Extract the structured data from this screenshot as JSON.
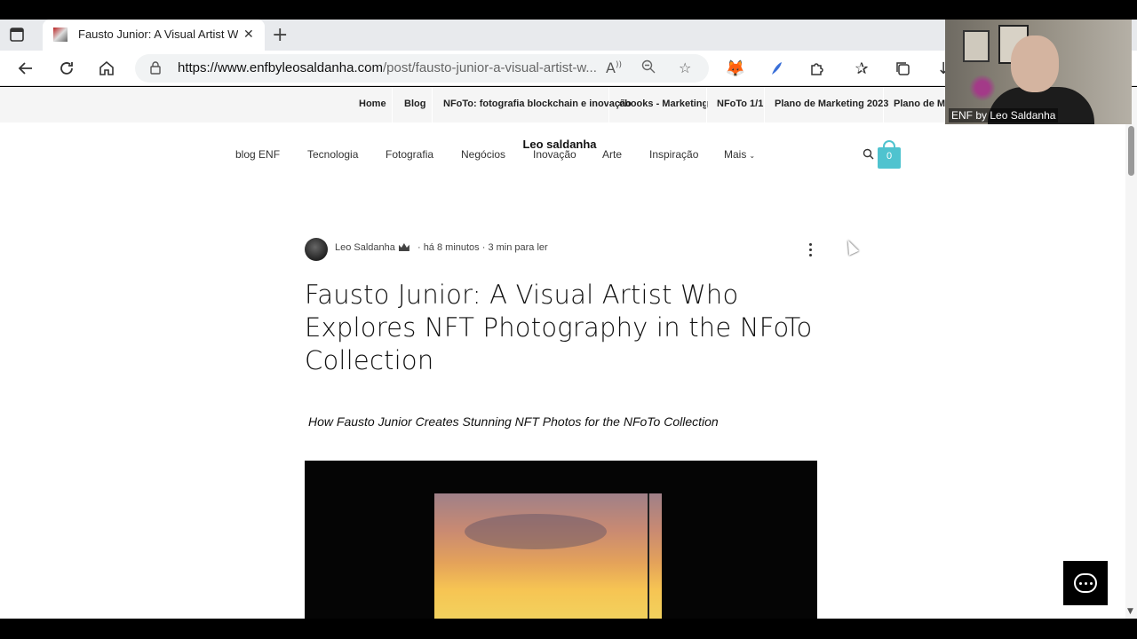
{
  "browser": {
    "tab_title": "Fausto Junior: A Visual Artist Who",
    "url_domain": "https://www.enfbyleosaldanha.com",
    "url_path": "/post/fausto-junior-a-visual-artist-w..."
  },
  "site_nav": {
    "links": [
      "Home",
      "Blog",
      "NFoTo: fotografia blockchain e inovação",
      "ebooks - Marketing",
      "NFoTo 1/1",
      "Plano de Marketing 2023",
      "Plano de Mar"
    ]
  },
  "site": {
    "brand": "Leo saldanha",
    "categories": [
      "blog ENF",
      "Tecnologia",
      "Fotografia",
      "Negócios",
      "Inovação",
      "Arte",
      "Inspiração",
      "Mais"
    ],
    "cart_count": "0"
  },
  "post": {
    "author": "Leo Saldanha",
    "time_ago": "há 8 minutos",
    "read_time": "3 min para ler",
    "title": "Fausto Junior: A Visual Artist Who Explores NFT Photography in the NFoTo Collection",
    "subtitle": "How Fausto Junior Creates Stunning NFT Photos for the NFoTo Collection"
  },
  "webcam": {
    "name": "ENF by Leo Saldanha"
  },
  "icons": [
    "tab-actions-icon",
    "close-icon",
    "plus-icon",
    "back-icon",
    "reload-icon",
    "home-icon",
    "lock-icon",
    "read-aloud-icon",
    "zoom-icon",
    "star-icon",
    "metamask-icon",
    "extension-feather-icon",
    "puzzle-icon",
    "favorites-icon",
    "collections-icon",
    "download-icon",
    "search-icon",
    "cart-icon",
    "kebab-menu-icon",
    "chat-icon",
    "chevron-down-icon"
  ]
}
